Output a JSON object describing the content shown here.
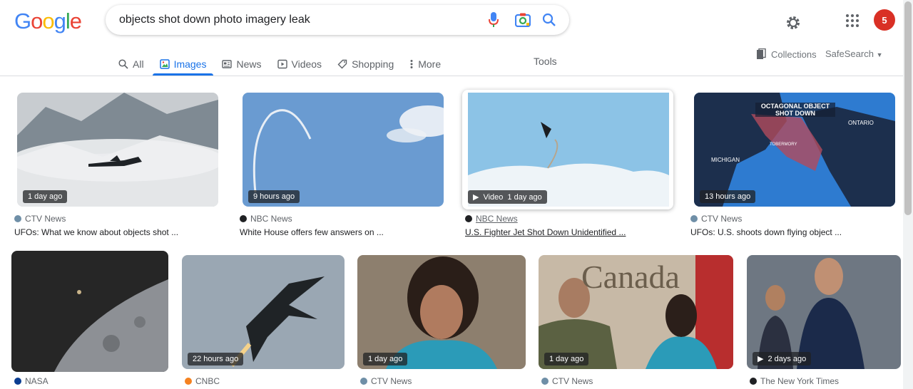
{
  "brand": {
    "logo_letters": [
      "G",
      "o",
      "o",
      "g",
      "l",
      "e"
    ],
    "logo_colors": [
      "#4285f4",
      "#ea4335",
      "#fbbc05",
      "#4285f4",
      "#34a853",
      "#ea4335"
    ]
  },
  "search": {
    "query": "objects shot down photo imagery leak"
  },
  "tabs": [
    {
      "label": "All",
      "icon": "search-icon"
    },
    {
      "label": "Images",
      "icon": "image-icon"
    },
    {
      "label": "News",
      "icon": "news-icon"
    },
    {
      "label": "Videos",
      "icon": "video-icon"
    },
    {
      "label": "Shopping",
      "icon": "tag-icon"
    },
    {
      "label": "More",
      "icon": "more-vert-icon"
    }
  ],
  "tools_label": "Tools",
  "collections_label": "Collections",
  "safesearch_label": "SafeSearch",
  "avatar_text": "5",
  "results": [
    {
      "time": "1 day ago",
      "source": "CTV News",
      "title": "UFOs: What we know about objects shot ...",
      "video": false,
      "fav_color": "#6f8fa7"
    },
    {
      "time": "9 hours ago",
      "source": "NBC News",
      "title": "White House offers few answers on ...",
      "video": false,
      "fav_color": "#202124"
    },
    {
      "time": "1 day ago",
      "source": "NBC News",
      "title": "U.S. Fighter Jet Shot Down Unidentified ...",
      "video": true,
      "video_label": "Video",
      "fav_color": "#202124"
    },
    {
      "time": "13 hours ago",
      "source": "CTV News",
      "title": "UFOs: U.S. shoots down flying object ...",
      "video": false,
      "fav_color": "#6f8fa7"
    },
    {
      "time": "",
      "source": "NASA",
      "title": "",
      "video": false,
      "fav_color": "#0b3d91"
    },
    {
      "time": "22 hours ago",
      "source": "CNBC",
      "title": "",
      "video": false,
      "fav_color": "#f58220"
    },
    {
      "time": "1 day ago",
      "source": "CTV News",
      "title": "",
      "video": false,
      "fav_color": "#6f8fa7"
    },
    {
      "time": "1 day ago",
      "source": "CTV News",
      "title": "",
      "video": false,
      "fav_color": "#6f8fa7"
    },
    {
      "time": "2 days ago",
      "source": "The New York Times",
      "title": "",
      "video": true,
      "video_label": "",
      "fav_color": "#202124"
    }
  ],
  "map_labels": {
    "title_line1": "OCTAGONAL OBJECT",
    "title_line2": "SHOT DOWN",
    "ontario": "ONTARIO",
    "tobermory": "TOBERMORY",
    "michigan": "MICHIGAN"
  },
  "sign_text": "Canada"
}
